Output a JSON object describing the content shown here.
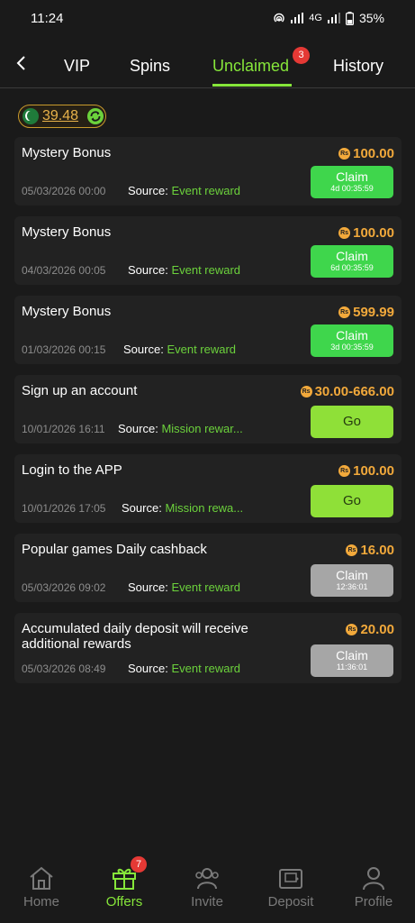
{
  "status": {
    "time": "11:24",
    "network": "4G",
    "battery": "35%"
  },
  "nav": {
    "tabs": [
      {
        "label": "VIP"
      },
      {
        "label": "Spins"
      },
      {
        "label": "Unclaimed",
        "badge": "3"
      },
      {
        "label": "History"
      }
    ],
    "active": "Unclaimed"
  },
  "balance": {
    "value": "39.48"
  },
  "rewards": [
    {
      "title": "Mystery Bonus",
      "amount": "100.00",
      "date": "05/03/2026 00:00",
      "source_label": "Source:",
      "source": "Event reward",
      "button": "Claim",
      "timer": "4d 00:35:59"
    },
    {
      "title": "Mystery Bonus",
      "amount": "100.00",
      "date": "04/03/2026 00:05",
      "source_label": "Source:",
      "source": "Event reward",
      "button": "Claim",
      "timer": "6d 00:35:59"
    },
    {
      "title": "Mystery Bonus",
      "amount": "599.99",
      "date": "01/03/2026 00:15",
      "source_label": "Source:",
      "source": "Event reward",
      "button": "Claim",
      "timer": "3d 00:35:59"
    },
    {
      "title": "Sign up an account",
      "amount": "30.00-666.00",
      "date": "10/01/2026 16:11",
      "source_label": "Source:",
      "source": "Mission rewar...",
      "button": "Go"
    },
    {
      "title": "Login to the APP",
      "amount": "100.00",
      "date": "10/01/2026 17:05",
      "source_label": "Source:",
      "source": "Mission rewa...",
      "button": "Go"
    },
    {
      "title": "Popular games Daily cashback",
      "amount": "16.00",
      "date": "05/03/2026 09:02",
      "source_label": "Source:",
      "source": "Event reward",
      "button": "Claim",
      "timer": "12:36:01"
    },
    {
      "title": "Accumulated daily deposit will receive additional rewards",
      "amount": "20.00",
      "date": "05/03/2026 08:49",
      "source_label": "Source:",
      "source": "Event reward",
      "button": "Claim",
      "timer": "11:36:01"
    }
  ],
  "currency_icon": "Rs",
  "bottom_nav": {
    "items": [
      {
        "label": "Home",
        "icon": "home-icon"
      },
      {
        "label": "Offers",
        "icon": "gift-icon",
        "badge": "7"
      },
      {
        "label": "Invite",
        "icon": "invite-icon"
      },
      {
        "label": "Deposit",
        "icon": "wallet-icon"
      },
      {
        "label": "Profile",
        "icon": "profile-icon"
      }
    ],
    "active": "Offers"
  },
  "colors": {
    "accent": "#86e63a",
    "amount": "#f2a93b",
    "claim": "#3fd64c",
    "go": "#8fe038",
    "disabled": "#a6a6a6",
    "badge": "#e53935"
  }
}
